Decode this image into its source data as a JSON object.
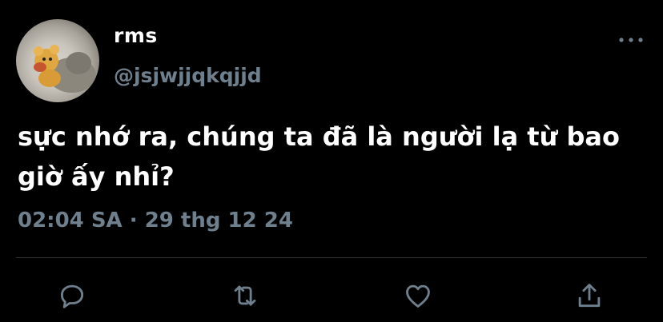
{
  "tweet": {
    "display_name": "rms",
    "handle": "@jsjwjjqkqjjd",
    "text": "sực nhớ ra, chúng ta đã là người lạ từ bao giờ ấy nhỉ?",
    "time": "02:04 SA",
    "separator": "·",
    "date": "29 thg 12 24"
  },
  "icons": {
    "more": "more-horizontal-icon",
    "reply": "reply-icon",
    "retweet": "retweet-icon",
    "like": "heart-icon",
    "share": "share-icon"
  },
  "colors": {
    "background": "#000000",
    "text": "#ffffff",
    "secondary": "#6e7f8d",
    "divider": "#2f3336"
  }
}
